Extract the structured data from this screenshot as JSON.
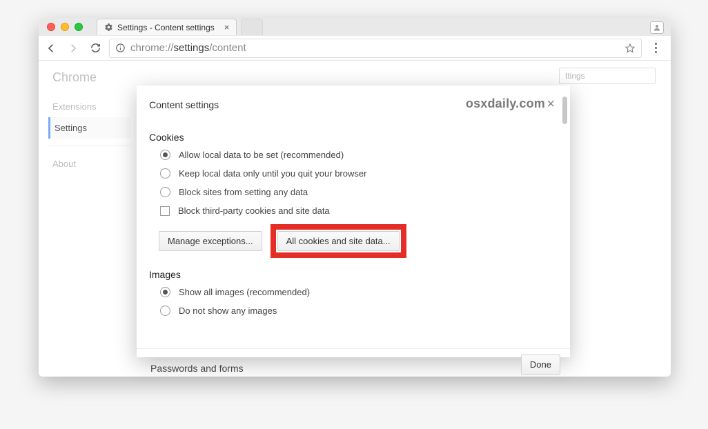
{
  "tab": {
    "title": "Settings - Content settings"
  },
  "url": {
    "protocol": "chrome://",
    "strong": "settings",
    "path": "/content"
  },
  "sidebar": {
    "title": "Chrome",
    "items": [
      "Extensions",
      "Settings",
      "About"
    ],
    "selected": 1
  },
  "search": {
    "placeholder": "ttings"
  },
  "bottom_peek": "Passwords and forms",
  "watermark": "osxdaily.com",
  "modal": {
    "title": "Content settings",
    "done": "Done",
    "sections": {
      "cookies": {
        "title": "Cookies",
        "options": [
          "Allow local data to be set (recommended)",
          "Keep local data only until you quit your browser",
          "Block sites from setting any data"
        ],
        "checkbox": "Block third-party cookies and site data",
        "manage_btn": "Manage exceptions...",
        "all_btn": "All cookies and site data..."
      },
      "images": {
        "title": "Images",
        "options": [
          "Show all images (recommended)",
          "Do not show any images"
        ]
      }
    }
  }
}
